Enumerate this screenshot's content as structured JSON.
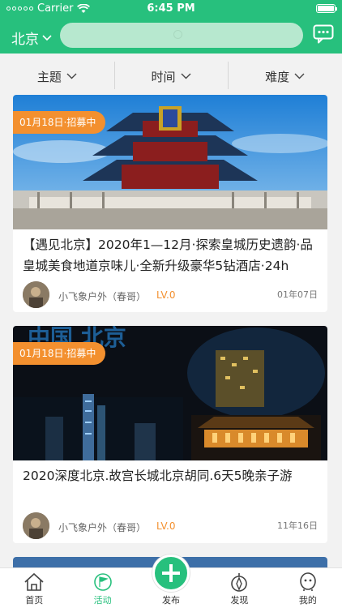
{
  "status_bar": {
    "carrier": "Carrier",
    "time": "6:45 PM"
  },
  "header": {
    "city": "北京",
    "search_placeholder": ""
  },
  "filters": [
    {
      "label": "主题"
    },
    {
      "label": "时间"
    },
    {
      "label": "难度"
    }
  ],
  "cards": [
    {
      "badge": "01月18日·招募中",
      "title": "【遇见北京】2020年1—12月·探索皇城历史遗韵·品皇城美食地道京味儿·全新升级豪华5钻酒店·24h",
      "author": "小飞象户外（春哥）",
      "level": "LV.0",
      "date": "01年07日"
    },
    {
      "badge": "01月18日·招募中",
      "title": "2020深度北京.故宫长城北京胡同.6天5晚亲子游",
      "author": "小飞象户外（春哥）",
      "level": "LV.0",
      "date": "11年16日",
      "photo_text": "中国 北京"
    }
  ],
  "tabbar": {
    "home": "首页",
    "activity": "活动",
    "publish": "发布",
    "discover": "发现",
    "mine": "我的"
  },
  "colors": {
    "brand": "#27c07d",
    "badge": "#f3902f"
  }
}
